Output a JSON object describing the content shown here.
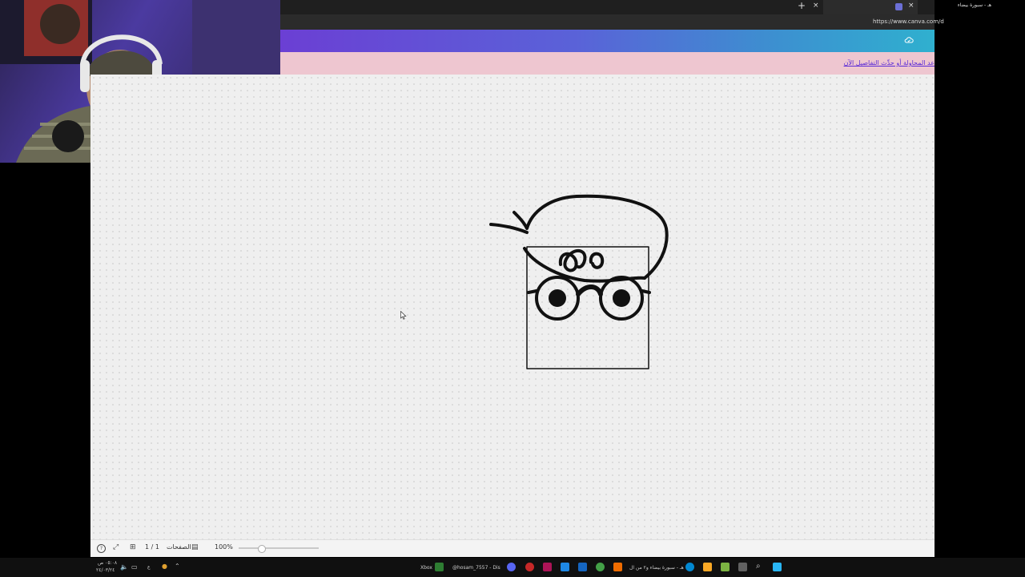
{
  "browser": {
    "active_tab_title": "هـ - سبورة بيضاء",
    "url": "https://www.canva.com/d",
    "new_tab_label": "+",
    "close_label": "×"
  },
  "banner": {
    "link_text": "عد المحاولة أو حدِّث التفاصيل الآن"
  },
  "bottombar": {
    "pages_count": "1 / 1",
    "pages_label": "الصفحات",
    "zoom": "100%",
    "zoom_fraction": 0.28
  },
  "taskbar": {
    "time": "٠٥:٠٨ ص",
    "date": "٢٤/٠٣/٢٤",
    "lang": "ع",
    "xbox_label": "Xbox",
    "discord_label": "@hosam_7557 - Dis",
    "browser_window_label": "هـ - سبورة بيضاء و٢ من ال"
  },
  "colors": {
    "header_gradient_start": "#6b3fd4",
    "header_gradient_end": "#2fb0cf",
    "banner_bg": "#eec6d0",
    "link": "#5a2bd6"
  }
}
